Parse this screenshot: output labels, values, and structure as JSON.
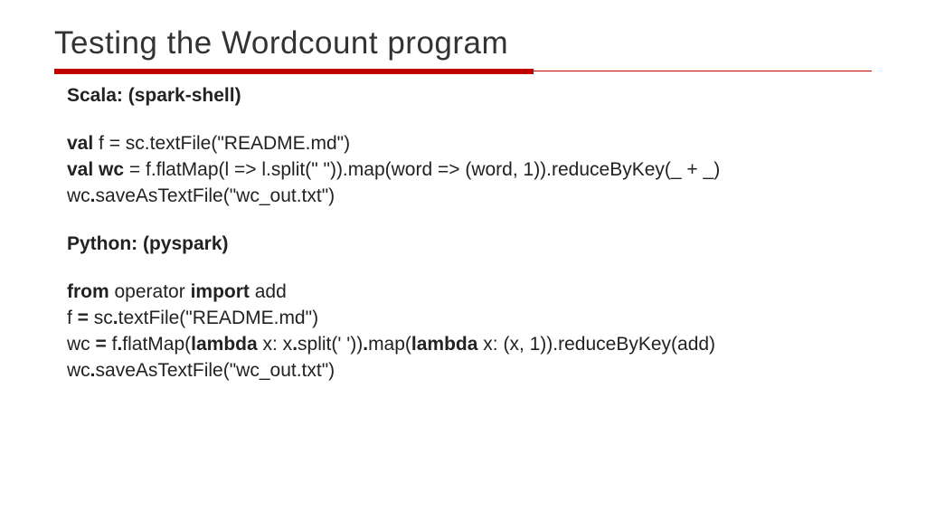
{
  "title": "Testing the Wordcount program",
  "scala": {
    "heading": "Scala: (spark-shell)",
    "l1_kw": "val",
    "l1_rest": " f = sc.textFile(\"README.md\")",
    "l2_kw": "val wc",
    "l2_rest": " = f.flatMap(l => l.split(\" \")).map(word => (word, 1)).reduceByKey(_ + _)",
    "l3_a": "wc",
    "l3_dot": ".",
    "l3_b": "saveAsTextFile(\"wc_out.txt\")"
  },
  "python": {
    "heading": "Python: (pyspark)",
    "l1_kw1": "from",
    "l1_mid": " operator ",
    "l1_kw2": "import",
    "l1_end": " add",
    "l2_a": "f ",
    "l2_eq": "=",
    "l2_b": " sc",
    "l2_dot": ".",
    "l2_c": "textFile(\"README.md\")",
    "l3_a": "wc ",
    "l3_eq": "=",
    "l3_b": " f",
    "l3_dot1": ".",
    "l3_c": "flatMap(",
    "l3_kw1": "lambda",
    "l3_d": " x: x",
    "l3_dot2": ".",
    "l3_e": "split(' '))",
    "l3_dot3": ".",
    "l3_f": "map(",
    "l3_kw2": "lambda",
    "l3_g": " x: (x, 1)).reduceByKey(add)",
    "l4_a": "wc",
    "l4_dot": ".",
    "l4_b": "saveAsTextFile(\"wc_out.txt\")"
  }
}
